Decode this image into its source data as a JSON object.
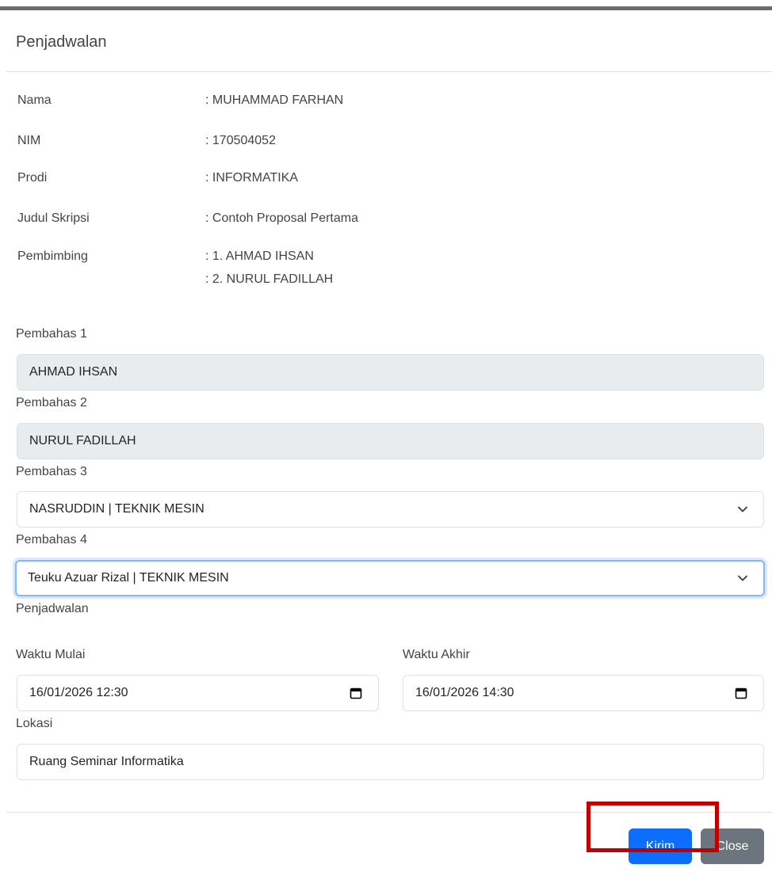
{
  "modal": {
    "title": "Penjadwalan"
  },
  "info": {
    "nama_label": "Nama",
    "nama_value": ": MUHAMMAD FARHAN",
    "nim_label": "NIM",
    "nim_value": ": 170504052",
    "prodi_label": "Prodi",
    "prodi_value": ": INFORMATIKA",
    "judul_label": "Judul Skripsi",
    "judul_value": ": Contoh Proposal Pertama",
    "pembimbing_label": "Pembimbing",
    "pembimbing_values": [
      ": 1. AHMAD IHSAN",
      ": 2. NURUL FADILLAH"
    ]
  },
  "form": {
    "pembahas1_label": "Pembahas 1",
    "pembahas1_value": "AHMAD IHSAN",
    "pembahas2_label": "Pembahas 2",
    "pembahas2_value": "NURUL FADILLAH",
    "pembahas3_label": "Pembahas 3",
    "pembahas3_value": "NASRUDDIN | TEKNIK MESIN",
    "pembahas4_label": "Pembahas 4",
    "pembahas4_value": "Teuku Azuar Rizal | TEKNIK MESIN",
    "section_label": "Penjadwalan",
    "waktu_mulai_label": "Waktu Mulai",
    "waktu_mulai_value": "16/01/2026 12:30",
    "waktu_akhir_label": "Waktu Akhir",
    "waktu_akhir_value": "16/01/2026 14:30",
    "lokasi_label": "Lokasi",
    "lokasi_value": "Ruang Seminar Informatika"
  },
  "footer": {
    "submit_label": "Kirim",
    "close_label": "Close"
  },
  "icons": {
    "select_indicator": "chevron-down-icon",
    "date_picker": "calendar-icon"
  },
  "colors": {
    "primary": "#0d6efd",
    "secondary": "#6c757d",
    "readonly_bg": "#e9ecef",
    "focus_border": "#86b7fe",
    "highlight": "#c00000"
  }
}
